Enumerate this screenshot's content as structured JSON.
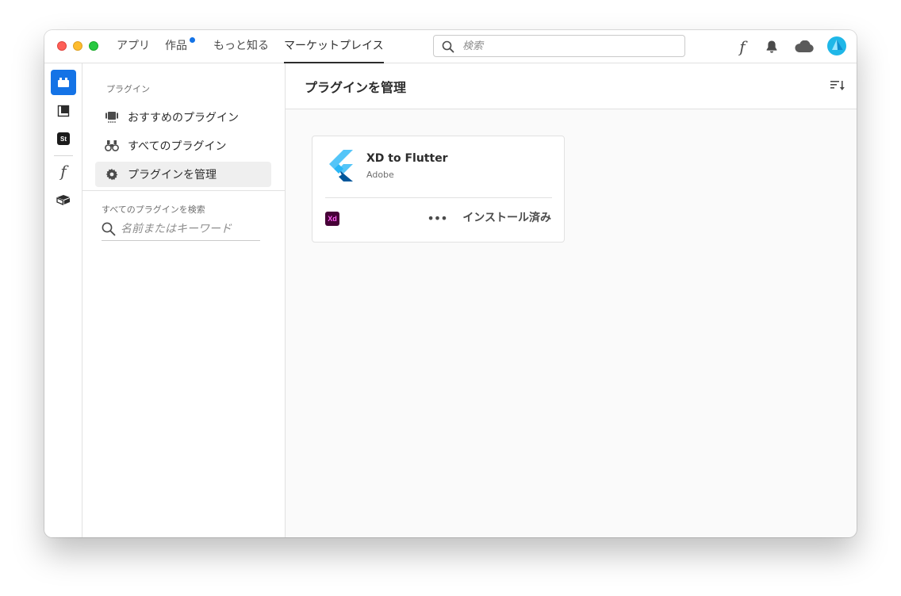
{
  "nav": {
    "tabs": [
      {
        "label": "アプリ"
      },
      {
        "label": "作品"
      },
      {
        "label": "もっと知る"
      },
      {
        "label": "マーケットプレイス"
      }
    ],
    "search_placeholder": "検索"
  },
  "colors": {
    "accent": "#1473e6",
    "notification_dot": "#1473e6",
    "xd_badge_bg": "#470137",
    "xd_badge_fg": "#ff61f6"
  },
  "icons": {
    "top_right": [
      "fonts-icon",
      "bell-icon",
      "cloud-icon",
      "avatar"
    ],
    "rail": [
      "plugins-icon",
      "libraries-icon",
      "stock-icon",
      "fonts-icon",
      "3d-box-icon"
    ]
  },
  "rail": {
    "stock_badge": "St"
  },
  "sidebar": {
    "heading": "プラグイン",
    "items": [
      {
        "label": "おすすめのプラグイン"
      },
      {
        "label": "すべてのプラグイン"
      },
      {
        "label": "プラグインを管理"
      }
    ],
    "search_label": "すべてのプラグインを検索",
    "search_placeholder": "名前またはキーワード"
  },
  "main": {
    "title": "プラグインを管理"
  },
  "plugin_card": {
    "name": "XD to Flutter",
    "publisher": "Adobe",
    "app_badge": "Xd",
    "more_label": "•••",
    "status": "インストール済み"
  }
}
